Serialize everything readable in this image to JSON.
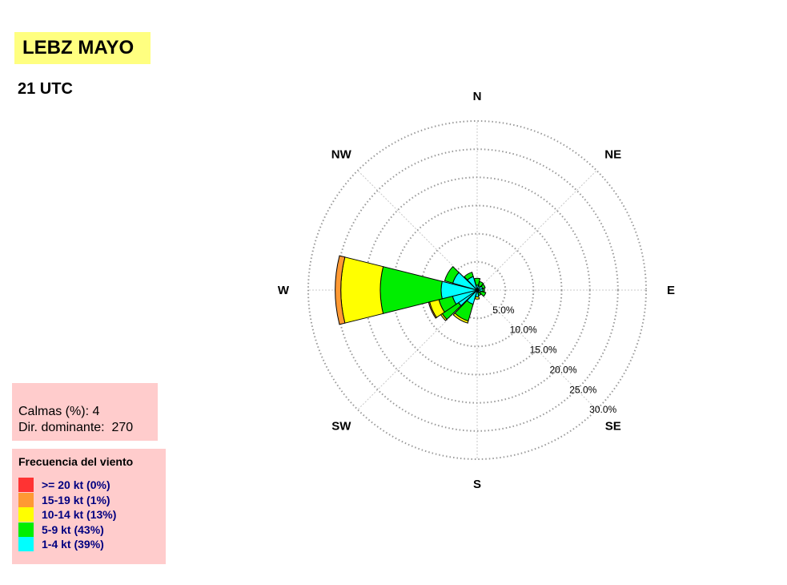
{
  "title": "LEBZ MAYO",
  "subtitle": "21 UTC",
  "stats": {
    "calms": "Calmas (%): 4",
    "dominant": "Dir. dominante:  270"
  },
  "legend": {
    "title": "Frecuencia del viento",
    "items": [
      {
        "label": ">= 20 kt (0%)",
        "color": "#ff3333"
      },
      {
        "label": "15-19 kt (1%)",
        "color": "#ff9933"
      },
      {
        "label": "10-14 kt (13%)",
        "color": "#ffff00"
      },
      {
        "label": "5-9 kt (43%)",
        "color": "#00ee00"
      },
      {
        "label": "1-4 kt (39%)",
        "color": "#00ffff"
      }
    ]
  },
  "chart_data": {
    "type": "windrose",
    "directions": [
      "N",
      "NE",
      "E",
      "SE",
      "S",
      "SW",
      "W",
      "NW"
    ],
    "ring_labels": [
      "5.0%",
      "10.0%",
      "15.0%",
      "20.0%",
      "25.0%",
      "30.0%"
    ],
    "rmax": 30,
    "grid": true,
    "series": [
      {
        "name": "1-4 kt",
        "color": "#00ffff"
      },
      {
        "name": "5-9 kt",
        "color": "#00ee00"
      },
      {
        "name": "10-14 kt",
        "color": "#ffff00"
      },
      {
        "name": "15-19 kt",
        "color": "#ff9933"
      },
      {
        "name": ">= 20 kt",
        "color": "#ff3333"
      }
    ],
    "sectors": [
      {
        "dir": 0,
        "values": [
          0.9,
          1.2,
          0,
          0,
          0
        ]
      },
      {
        "dir": 30,
        "values": [
          0.8,
          0.8,
          0,
          0,
          0
        ]
      },
      {
        "dir": 60,
        "values": [
          1.0,
          0.5,
          0,
          0,
          0
        ]
      },
      {
        "dir": 90,
        "values": [
          1.0,
          0.3,
          0,
          0,
          0
        ]
      },
      {
        "dir": 120,
        "values": [
          0.7,
          0.9,
          0,
          0,
          0
        ]
      },
      {
        "dir": 150,
        "values": [
          0.5,
          0.5,
          0,
          0,
          0
        ]
      },
      {
        "dir": 180,
        "values": [
          1.2,
          0,
          0.4,
          0,
          0
        ]
      },
      {
        "dir": 210,
        "values": [
          2.6,
          3.1,
          0.4,
          0,
          0
        ]
      },
      {
        "dir": 240,
        "values": [
          4.0,
          3.5,
          0.3,
          0,
          0
        ]
      },
      {
        "dir": 250,
        "values": [
          4.5,
          2.5,
          1.7,
          0.2,
          0
        ]
      },
      {
        "dir": 270,
        "values": [
          6.4,
          10.8,
          7.0,
          1.0,
          0
        ]
      },
      {
        "dir": 300,
        "values": [
          4.5,
          1.5,
          0,
          0,
          0
        ]
      },
      {
        "dir": 330,
        "values": [
          2.5,
          0.8,
          0,
          0,
          0
        ]
      }
    ]
  }
}
